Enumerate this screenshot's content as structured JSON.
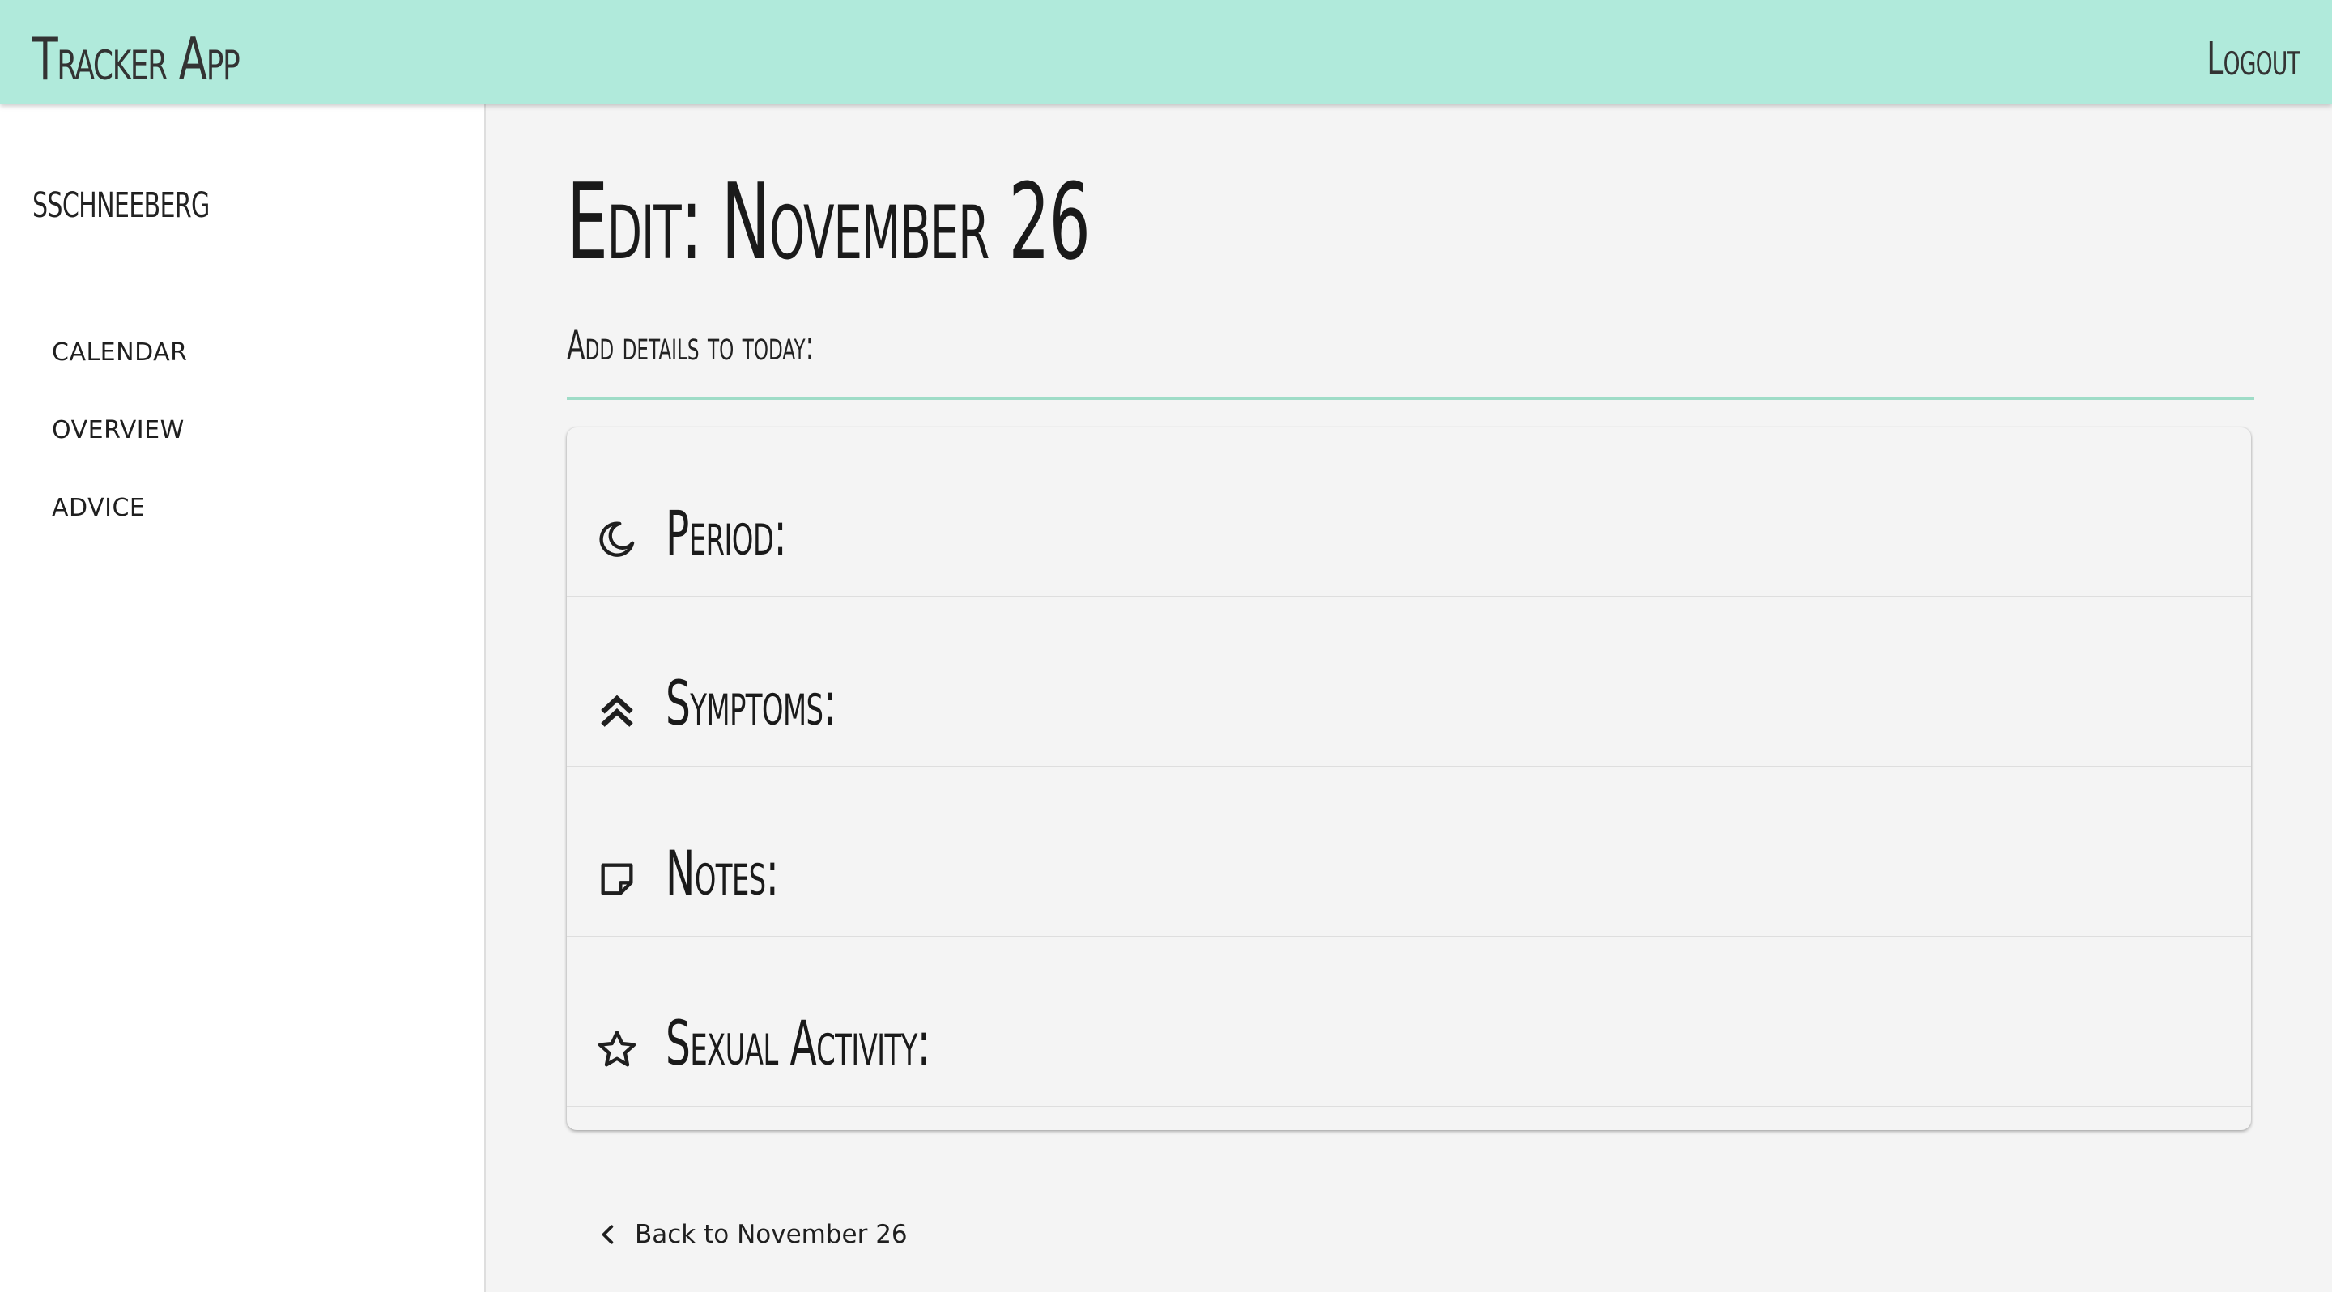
{
  "header": {
    "app_title": "Tracker App",
    "logout_label": "Logout",
    "background_color": "#b0eadb"
  },
  "sidebar": {
    "username": "sschneeberg",
    "items": [
      {
        "label": "CALENDAR"
      },
      {
        "label": "OVERVIEW"
      },
      {
        "label": "ADVICE"
      }
    ]
  },
  "main": {
    "title": "Edit: November 26",
    "subtitle": "Add details to today:",
    "accent_color": "#9fdcc7",
    "details": [
      {
        "label": "Period:",
        "icon": "moon-icon"
      },
      {
        "label": "Symptoms:",
        "icon": "double-chevron-up-icon"
      },
      {
        "label": "Notes:",
        "icon": "sticky-note-icon"
      },
      {
        "label": "Sexual Activity:",
        "icon": "star-icon"
      }
    ],
    "back_link": {
      "label": "Back to November 26",
      "icon": "chevron-left-icon"
    }
  }
}
